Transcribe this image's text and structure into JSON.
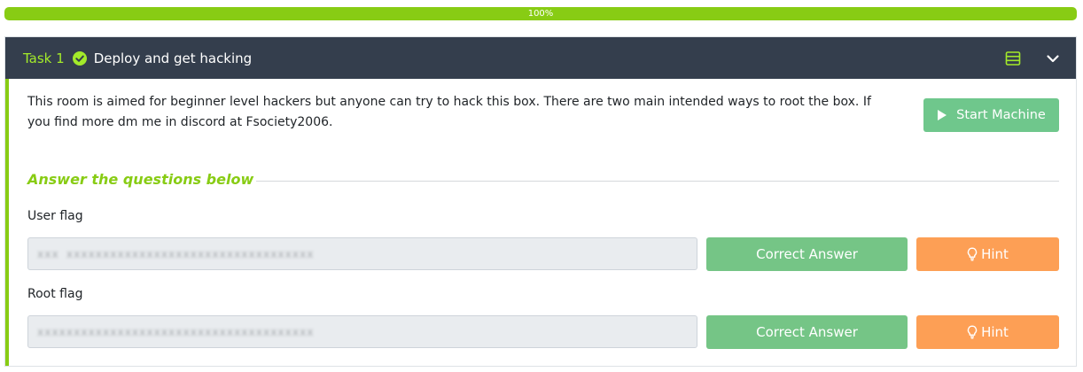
{
  "progress": {
    "label": "100%",
    "fraction": 1.0
  },
  "task": {
    "number_label": "Task 1",
    "title": "Deploy and get hacking",
    "status_icon": "check-circle-icon",
    "header_icons": [
      "list-icon",
      "chevron-down-icon"
    ]
  },
  "body": {
    "description": "This room is aimed for beginner level hackers but anyone can try to hack this box. There are two main intended ways to root the box. If you find more dm me in discord at Fsociety2006.",
    "start_button_label": "Start Machine",
    "answer_heading": "Answer the questions below"
  },
  "questions": [
    {
      "label": "User flag",
      "answer_value": "xxx xxxxxxxxxxxxxxxxxxxxxxxxxxxxxxxxxx",
      "submit_label": "Correct Answer",
      "hint_label": "Hint"
    },
    {
      "label": "Root flag",
      "answer_value": "xxxxxxxxxxxxxxxxxxxxxxxxxxxxxxxxxxxxxx",
      "submit_label": "Correct Answer",
      "hint_label": "Hint"
    }
  ],
  "colors": {
    "accent_green": "#88cc14",
    "header_bg": "#343e4d",
    "correct_button": "#75c586",
    "hint_button": "#fd9f55",
    "start_button": "#68c586"
  }
}
